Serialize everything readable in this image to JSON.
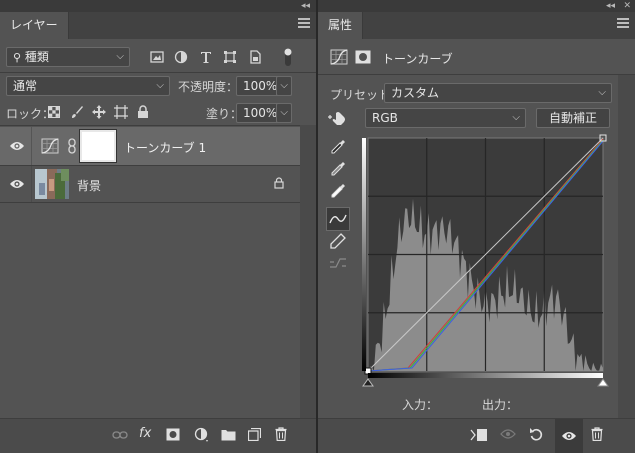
{
  "layers_panel": {
    "tab": "レイヤー",
    "filter_kind": "種類",
    "blend_mode": "通常",
    "opacity_label": "不透明度：",
    "opacity_value": "100%",
    "lock_label": "ロック：",
    "fill_label": "塗り：",
    "fill_value": "100%",
    "layers": [
      {
        "name": "トーンカーブ 1",
        "type": "adjustment",
        "selected": true
      },
      {
        "name": "背景",
        "type": "background",
        "selected": false
      }
    ]
  },
  "properties_panel": {
    "tab": "属性",
    "title": "トーンカーブ",
    "preset_label": "プリセット：",
    "preset_value": "カスタム",
    "channel_value": "RGB",
    "auto_button": "自動補正",
    "input_label": "入力：",
    "output_label": "出力："
  },
  "icons": {
    "visibility": "eye-icon",
    "lock": "lock-icon",
    "link": "link-icon",
    "fx": "fx",
    "search": "search-icon"
  },
  "colors": {
    "panel_bg": "#535353",
    "selected_row": "#696969",
    "histogram": "#8c8c8c",
    "curve_red": "#d04040",
    "curve_green": "#40b040",
    "curve_blue": "#4060e0"
  }
}
